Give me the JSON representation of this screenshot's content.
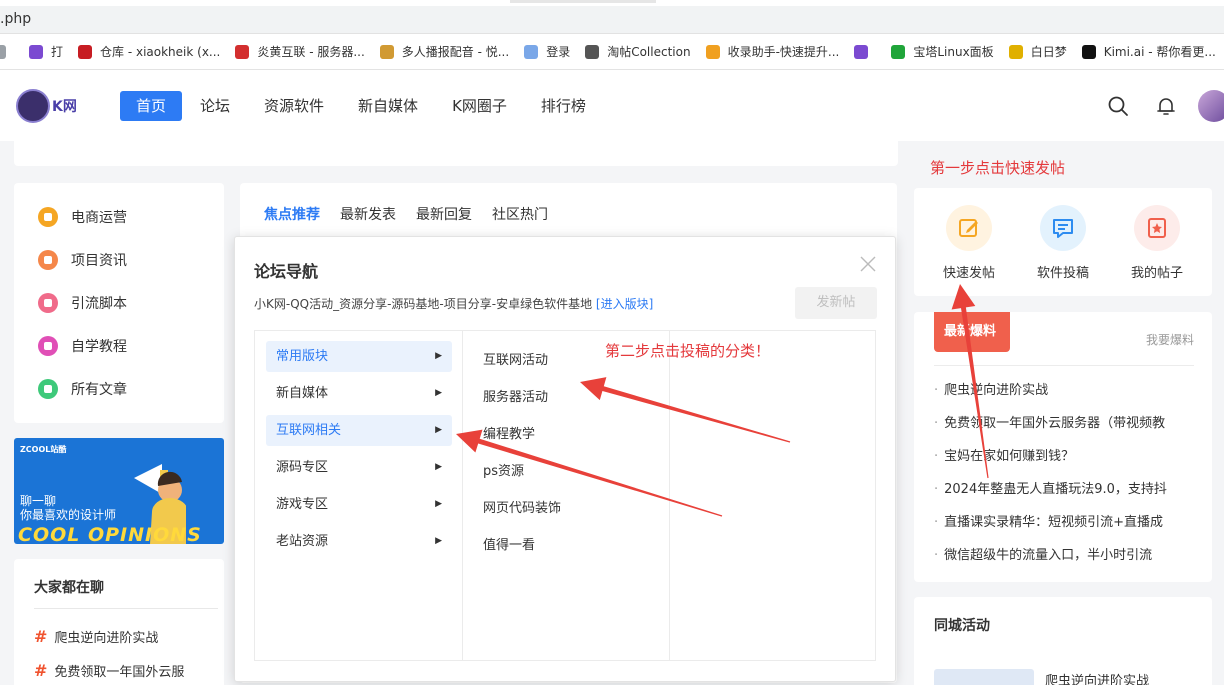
{
  "browser": {
    "url_fragment": ".php",
    "bookmarks": [
      {
        "label": "",
        "icon": "partial-bookmark-icon",
        "color": "#9aa0a6"
      },
      {
        "label": "打",
        "icon": "k-logo-icon",
        "color": "#7b4ad1"
      },
      {
        "label": "仓库 - xiaokheik (x...",
        "icon": "gitee-logo-icon",
        "color": "#c71d23"
      },
      {
        "label": "炎黄互联 - 服务器...",
        "icon": "yanhuang-logo-icon",
        "color": "#d32f2f"
      },
      {
        "label": "多人播报配音 - 悦...",
        "icon": "yue-logo-icon",
        "color": "#d19a33"
      },
      {
        "label": "登录",
        "icon": "info-icon",
        "color": "#7aa7e8"
      },
      {
        "label": "淘帖Collection",
        "icon": "globe-icon",
        "color": "#555555"
      },
      {
        "label": "收录助手-快速提升...",
        "icon": "rocket-icon",
        "color": "#f0a020"
      },
      {
        "label": "",
        "icon": "k-logo-icon",
        "color": "#7b4ad1"
      },
      {
        "label": "宝塔Linux面板",
        "icon": "shield-icon",
        "color": "#20a53a"
      },
      {
        "label": "白日梦",
        "icon": "dream-logo-icon",
        "color": "#e0b000"
      },
      {
        "label": "Kimi.ai - 帮你看更...",
        "icon": "kimi-logo-icon",
        "color": "#111111"
      }
    ]
  },
  "header": {
    "logo_text": "K网",
    "nav": [
      "首页",
      "论坛",
      "资源软件",
      "新自媒体",
      "K网圈子",
      "排行榜"
    ]
  },
  "left": {
    "categories": [
      {
        "label": "电商运营",
        "color": "#f5a623"
      },
      {
        "label": "项目资讯",
        "color": "#f5874a"
      },
      {
        "label": "引流脚本",
        "color": "#f06b8a"
      },
      {
        "label": "自学教程",
        "color": "#e04fb6"
      },
      {
        "label": "所有文章",
        "color": "#3ec97a"
      }
    ],
    "ad": {
      "brand": "ZCOOL站酷",
      "line1": "聊一聊",
      "line2": "你最喜欢的设计师",
      "big": "COOL OPINIONS"
    },
    "chat_title": "大家都在聊",
    "chat_topics": [
      "爬虫逆向进阶实战",
      "免费领取一年国外云服"
    ]
  },
  "main": {
    "tabs": [
      "焦点推荐",
      "最新发表",
      "最新回复",
      "社区热门"
    ]
  },
  "popup": {
    "title": "论坛导航",
    "desc": "小K网-QQ活动_资源分享-源码基地-项目分享-安卓绿色软件基地 ",
    "enter_link": "[进入版块]",
    "post_button": "发新帖",
    "categories": [
      "常用版块",
      "新自媒体",
      "互联网相关",
      "源码专区",
      "游戏专区",
      "老站资源"
    ],
    "subitems": [
      "互联网活动",
      "服务器活动",
      "编程教学",
      "ps资源",
      "网页代码装饰",
      "值得一看"
    ]
  },
  "annotations": {
    "step1": "第一步点击快速发帖",
    "step2": "第二步点击投稿的分类！",
    "arrow_color": "#e8413a"
  },
  "right": {
    "quick": [
      {
        "label": "快速发帖",
        "bg": "#fff3e0",
        "color": "#f5a623"
      },
      {
        "label": "软件投稿",
        "bg": "#e3f2fd",
        "color": "#2d8cf0"
      },
      {
        "label": "我的帖子",
        "bg": "#fdecea",
        "color": "#f0604c"
      }
    ],
    "hot_badge": "最新爆料",
    "hot_more": "我要爆料",
    "hot_list": [
      "爬虫逆向进阶实战",
      "免费领取一年国外云服务器（带视频教",
      "宝妈在家如何赚到钱？",
      "2024年整蛊无人直播玩法9.0，支持抖",
      "直播课实录精华：短视频引流+直播成",
      "微信超级牛的流量入口，半小时引流"
    ],
    "city_title": "同城活动",
    "city_item": "爬虫逆向进阶实战"
  }
}
